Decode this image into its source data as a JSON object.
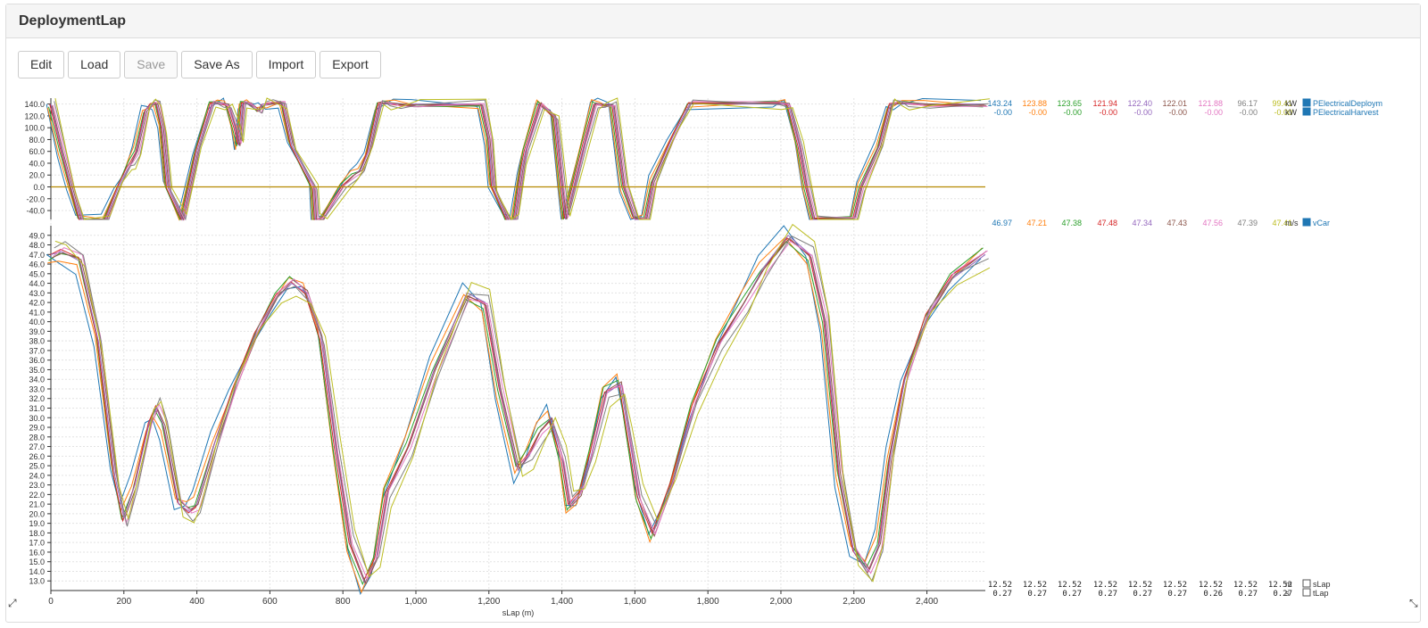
{
  "title": "DeploymentLap",
  "toolbar": {
    "edit": "Edit",
    "load": "Load",
    "save": "Save",
    "save_as": "Save As",
    "import": "Import",
    "export": "Export"
  },
  "icons": {
    "resize_left": "resize-diagonal-icon",
    "resize_right": "resize-diagonal-icon"
  },
  "chart_data": {
    "type": "line",
    "xlabel": "sLap (m)",
    "xlim": [
      0,
      2560
    ],
    "xticks": [
      0,
      200,
      400,
      600,
      800,
      1000,
      1200,
      1400,
      1600,
      1800,
      2000,
      2200,
      2400
    ],
    "xtick_labels": [
      "0",
      "200",
      "400",
      "600",
      "800",
      "1,000",
      "1,200",
      "1,400",
      "1,600",
      "1,800",
      "2,000",
      "2,200",
      "2,400"
    ],
    "grid": true,
    "colors": [
      "#1f77b4",
      "#ff7f0e",
      "#2ca02c",
      "#d62728",
      "#9467bd",
      "#8c564b",
      "#e377c2",
      "#7f7f7f",
      "#bcbd22"
    ],
    "panels": [
      {
        "ylim": [
          -55,
          150
        ],
        "yticks": [
          -40,
          -20,
          0,
          20,
          40,
          60,
          80,
          100,
          120,
          140
        ],
        "ytick_labels": [
          "-40.0",
          "-20.0",
          "0.0",
          "20.0",
          "40.0",
          "60.0",
          "80.0",
          "100.0",
          "120.0",
          "140.0"
        ],
        "series": [
          {
            "name": "PElectricalDeploym",
            "unit": "kW",
            "readout": [
              "143.24",
              "123.88",
              "123.65",
              "121.94",
              "122.40",
              "122.01",
              "121.88",
              "96.17",
              "99.41"
            ],
            "x": [
              0,
              30,
              55,
              80,
              150,
              185,
              210,
              220,
              235,
              260,
              275,
              290,
              305,
              320,
              360,
              400,
              440,
              465,
              485,
              505,
              515,
              525,
              545,
              570,
              580,
              600,
              635,
              660,
              720,
              725,
              745,
              800,
              830,
              850,
              870,
              900,
              920,
              950,
              1000,
              1180,
              1200,
              1210,
              1250,
              1270,
              1290,
              1300,
              1340,
              1380,
              1400,
              1410,
              1460,
              1490,
              1510,
              1540,
              1570,
              1600,
              1630,
              1650,
              1700,
              1750,
              1990,
              2020,
              2050,
              2070,
              2090,
              2200,
              2220,
              2270,
              2300,
              2320,
              2340,
              2400,
              2560
            ],
            "y": [
              140,
              60,
              0,
              -55,
              -55,
              0,
              30,
              40,
              60,
              130,
              140,
              140,
              100,
              0,
              -55,
              60,
              140,
              140,
              140,
              100,
              70,
              140,
              140,
              130,
              140,
              140,
              140,
              70,
              0,
              -55,
              -55,
              0,
              20,
              30,
              60,
              140,
              140,
              140,
              140,
              140,
              80,
              0,
              -55,
              -55,
              30,
              60,
              140,
              120,
              0,
              -55,
              70,
              140,
              140,
              140,
              0,
              -55,
              -55,
              10,
              80,
              140,
              140,
              140,
              70,
              0,
              -55,
              -55,
              0,
              70,
              140,
              140,
              140,
              140,
              140
            ]
          },
          {
            "name": "PElectricalHarvest",
            "unit": "kW",
            "readout": [
              "-0.00",
              "-0.00",
              "-0.00",
              "-0.00",
              "-0.00",
              "-0.00",
              "-0.00",
              "-0.00",
              "-0.00"
            ],
            "x": [
              0,
              2560
            ],
            "y": [
              0,
              0
            ]
          }
        ]
      },
      {
        "ylim": [
          12,
          50
        ],
        "yticks": [
          13,
          14,
          15,
          16,
          17,
          18,
          19,
          20,
          21,
          22,
          23,
          24,
          25,
          26,
          27,
          28,
          29,
          30,
          31,
          32,
          33,
          34,
          35,
          36,
          37,
          38,
          39,
          40,
          41,
          42,
          43,
          44,
          45,
          46,
          47,
          48,
          49
        ],
        "ytick_labels": [
          "13.0",
          "14.0",
          "15.0",
          "16.0",
          "17.0",
          "18.0",
          "19.0",
          "20.0",
          "21.0",
          "22.0",
          "23.0",
          "24.0",
          "25.0",
          "26.0",
          "27.0",
          "28.0",
          "29.0",
          "30.0",
          "31.0",
          "32.0",
          "33.0",
          "34.0",
          "35.0",
          "36.0",
          "37.0",
          "38.0",
          "39.0",
          "40.0",
          "41.0",
          "42.0",
          "43.0",
          "44.0",
          "45.0",
          "46.0",
          "47.0",
          "48.0",
          "49.0"
        ],
        "series": [
          {
            "name": "vCar",
            "unit": "m/s",
            "readout": [
              "46.97",
              "47.21",
              "47.38",
              "47.48",
              "47.34",
              "47.43",
              "47.56",
              "47.39",
              "47.41"
            ],
            "x": [
              0,
              30,
              80,
              130,
              175,
              200,
              230,
              270,
              290,
              310,
              350,
              380,
              400,
              450,
              500,
              560,
              620,
              660,
              700,
              740,
              780,
              820,
              860,
              890,
              920,
              980,
              1050,
              1140,
              1190,
              1230,
              1280,
              1310,
              1340,
              1370,
              1400,
              1420,
              1450,
              1480,
              1520,
              1560,
              1580,
              1610,
              1650,
              1700,
              1760,
              1830,
              1900,
              1950,
              2020,
              2080,
              2120,
              2160,
              2200,
              2240,
              2270,
              2300,
              2340,
              2400,
              2470,
              2560
            ],
            "y": [
              47,
              47.3,
              46.3,
              38,
              24,
              19.6,
              23,
              29.5,
              31,
              29,
              21,
              20.2,
              21,
              27.5,
              33,
              38.5,
              42.5,
              44,
              43,
              38.5,
              27,
              17,
              12.8,
              15,
              22,
              27,
              35,
              43,
              42,
              33,
              24.5,
              26,
              28.5,
              30,
              26,
              21,
              22,
              26,
              32.5,
              33.5,
              29,
              22,
              18,
              23,
              31,
              37.5,
              42,
              45.5,
              49,
              47,
              40,
              24,
              16,
              14,
              17,
              26,
              34,
              40.5,
              44.5,
              47
            ]
          }
        ]
      },
      {
        "series": [
          {
            "name": "sLap",
            "unit": "m",
            "readout": [
              "12.52",
              "12.52",
              "12.52",
              "12.52",
              "12.52",
              "12.52",
              "12.52",
              "12.52",
              "12.52"
            ]
          },
          {
            "name": "tLap",
            "unit": "s",
            "readout": [
              "0.27",
              "0.27",
              "0.27",
              "0.27",
              "0.27",
              "0.27",
              "0.26",
              "0.27",
              "0.27"
            ]
          }
        ]
      }
    ]
  }
}
